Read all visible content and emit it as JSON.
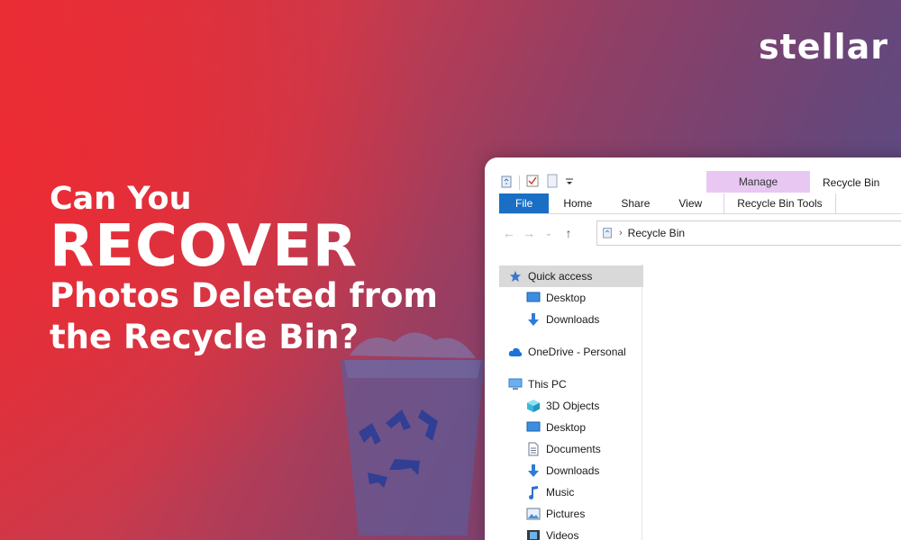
{
  "brand": {
    "logo": "stellar"
  },
  "headline": {
    "line1": "Can You",
    "line2": "RECOVER",
    "line3": "Photos Deleted from",
    "line4": "the Recycle Bin?"
  },
  "explorer": {
    "title": "Recycle Bin",
    "context_tab": "Manage",
    "ribbon_tabs": {
      "file": "File",
      "home": "Home",
      "share": "Share",
      "view": "View",
      "tools": "Recycle Bin Tools"
    },
    "address": "Recycle Bin",
    "nav": {
      "quick_access": "Quick access",
      "qa_desktop": "Desktop",
      "qa_downloads": "Downloads",
      "onedrive": "OneDrive - Personal",
      "this_pc": "This PC",
      "objects3d": "3D Objects",
      "desktop": "Desktop",
      "documents": "Documents",
      "downloads": "Downloads",
      "music": "Music",
      "pictures": "Pictures",
      "videos": "Videos"
    }
  },
  "colors": {
    "accent_red": "#e82e36",
    "accent_blue": "#47528f",
    "file_tab": "#1a6fc4",
    "manage_tab": "#e8c8f3"
  }
}
